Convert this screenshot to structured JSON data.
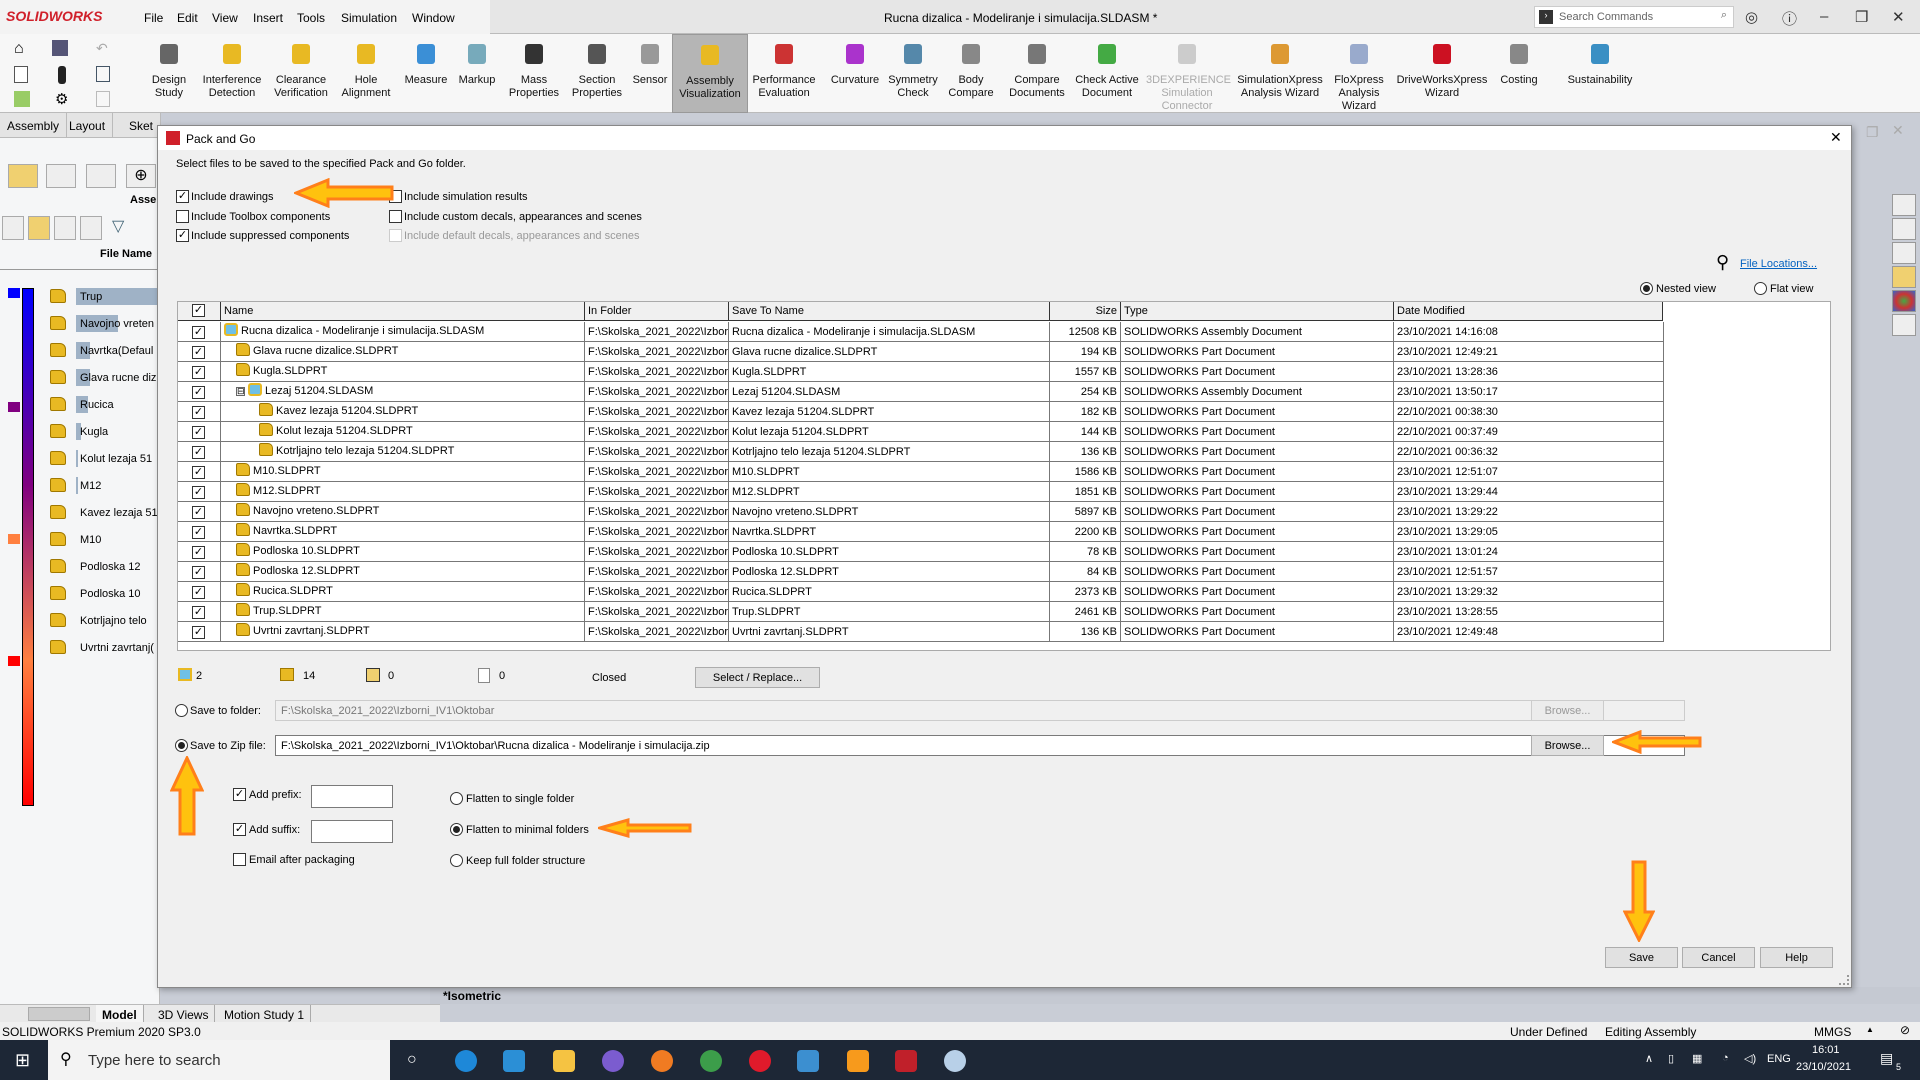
{
  "app": {
    "logo": "SOLIDWORKS",
    "title": "Rucna dizalica - Modeliranje i simulacija.SLDASM *",
    "menu": [
      "File",
      "Edit",
      "View",
      "Insert",
      "Tools",
      "Simulation",
      "Window"
    ],
    "search_placeholder": "Search Commands"
  },
  "toolbar": [
    {
      "l1": "Design",
      "l2": "Study",
      "c": "#666"
    },
    {
      "l1": "Interference",
      "l2": "Detection",
      "c": "#e8b923"
    },
    {
      "l1": "Clearance",
      "l2": "Verification",
      "c": "#e8b923"
    },
    {
      "l1": "Hole",
      "l2": "Alignment",
      "c": "#e8b923"
    },
    {
      "l1": "Measure",
      "l2": "",
      "c": "#3b8fd6"
    },
    {
      "l1": "Markup",
      "l2": "",
      "c": "#7ab"
    },
    {
      "l1": "Mass",
      "l2": "Properties",
      "c": "#333"
    },
    {
      "l1": "Section",
      "l2": "Properties",
      "c": "#555"
    },
    {
      "l1": "Sensor",
      "l2": "",
      "c": "#999"
    },
    {
      "l1": "Assembly",
      "l2": "Visualization",
      "c": "#e8b923",
      "active": true
    },
    {
      "l1": "Performance",
      "l2": "Evaluation",
      "c": "#c33"
    },
    {
      "l1": "Curvature",
      "l2": "",
      "c": "#a3c"
    },
    {
      "l1": "Symmetry",
      "l2": "Check",
      "c": "#58a"
    },
    {
      "l1": "Body",
      "l2": "Compare",
      "c": "#888"
    },
    {
      "l1": "Compare",
      "l2": "Documents",
      "c": "#777"
    },
    {
      "l1": "Check Active",
      "l2": "Document",
      "c": "#4a4"
    },
    {
      "l1": "3DEXPERIENCE",
      "l2": "Simulation",
      "l3": "Connector",
      "c": "#ccc",
      "disabled": true
    },
    {
      "l1": "SimulationXpress",
      "l2": "Analysis Wizard",
      "c": "#d93"
    },
    {
      "l1": "FloXpress",
      "l2": "Analysis",
      "l3": "Wizard",
      "c": "#9ac"
    },
    {
      "l1": "DriveWorksXpress",
      "l2": "Wizard",
      "c": "#c12"
    },
    {
      "l1": "Costing",
      "l2": "",
      "c": "#888"
    },
    {
      "l1": "Sustainability",
      "l2": "",
      "c": "#3a8fc4"
    }
  ],
  "cmd_tabs": [
    "Assembly",
    "Layout",
    "Sket"
  ],
  "left_panel": {
    "header": "Asse",
    "column": "File Name",
    "items": [
      {
        "name": "Trup",
        "fill": 1.0
      },
      {
        "name": "Navojno vreten",
        "fill": 0.5
      },
      {
        "name": "Navrtka(Defaul",
        "fill": 0.17
      },
      {
        "name": "Glava rucne diz",
        "fill": 0.17
      },
      {
        "name": "Rucica",
        "fill": 0.14
      },
      {
        "name": "Kugla",
        "fill": 0.06
      },
      {
        "name": "Kolut lezaja 51",
        "fill": 0.02
      },
      {
        "name": "M12",
        "fill": 0.02
      },
      {
        "name": "Kavez lezaja 51",
        "fill": 0
      },
      {
        "name": "M10",
        "fill": 0
      },
      {
        "name": "Podloska 12",
        "fill": 0
      },
      {
        "name": "Podloska 10",
        "fill": 0
      },
      {
        "name": "Kotrljajno telo",
        "fill": 0
      },
      {
        "name": "Uvrtni zavrtanj(",
        "fill": 0
      }
    ],
    "scale_colors": [
      "#0000ff",
      "#800080",
      "#ff8040",
      "#ff0000"
    ]
  },
  "dialog": {
    "title": "Pack and Go",
    "intro": "Select files to be saved to the specified Pack and Go folder.",
    "options": [
      {
        "label": "Include drawings",
        "checked": true
      },
      {
        "label": "Include Toolbox components",
        "checked": false
      },
      {
        "label": "Include suppressed components",
        "checked": true
      },
      {
        "label": "Include simulation results",
        "checked": false
      },
      {
        "label": "Include custom decals, appearances and scenes",
        "checked": false
      },
      {
        "label": "Include default decals, appearances and scenes",
        "checked": false,
        "disabled": true
      }
    ],
    "file_locations": "File Locations...",
    "views": [
      {
        "label": "Nested view",
        "selected": true
      },
      {
        "label": "Flat view",
        "selected": false
      }
    ],
    "columns": [
      "Name",
      "In Folder",
      "Save To Name",
      "Size",
      "Type",
      "Date Modified"
    ],
    "rows": [
      {
        "name": "Rucna dizalica - Modeliranje i simulacija.SLDASM",
        "kind": "asm",
        "level": 0,
        "folder": "F:\\Skolska_2021_2022\\Izbor",
        "save": "Rucna dizalica - Modeliranje i simulacija.SLDASM",
        "size": "12508 KB",
        "type": "SOLIDWORKS Assembly Document",
        "date": "23/10/2021 14:16:08"
      },
      {
        "name": "Glava rucne dizalice.SLDPRT",
        "kind": "prt",
        "level": 1,
        "folder": "F:\\Skolska_2021_2022\\Izbor",
        "save": "Glava rucne dizalice.SLDPRT",
        "size": "194 KB",
        "type": "SOLIDWORKS Part Document",
        "date": "23/10/2021 12:49:21"
      },
      {
        "name": "Kugla.SLDPRT",
        "kind": "prt",
        "level": 1,
        "folder": "F:\\Skolska_2021_2022\\Izbor",
        "save": "Kugla.SLDPRT",
        "size": "1557 KB",
        "type": "SOLIDWORKS Part Document",
        "date": "23/10/2021 13:28:36"
      },
      {
        "name": "Lezaj 51204.SLDASM",
        "kind": "asm",
        "level": 1,
        "expander": "⊟",
        "folder": "F:\\Skolska_2021_2022\\Izbor",
        "save": "Lezaj 51204.SLDASM",
        "size": "254 KB",
        "type": "SOLIDWORKS Assembly Document",
        "date": "23/10/2021 13:50:17"
      },
      {
        "name": "Kavez lezaja 51204.SLDPRT",
        "kind": "prt",
        "level": 2,
        "folder": "F:\\Skolska_2021_2022\\Izbor",
        "save": "Kavez lezaja 51204.SLDPRT",
        "size": "182 KB",
        "type": "SOLIDWORKS Part Document",
        "date": "22/10/2021 00:38:30"
      },
      {
        "name": "Kolut lezaja 51204.SLDPRT",
        "kind": "prt",
        "level": 2,
        "folder": "F:\\Skolska_2021_2022\\Izbor",
        "save": "Kolut lezaja 51204.SLDPRT",
        "size": "144 KB",
        "type": "SOLIDWORKS Part Document",
        "date": "22/10/2021 00:37:49"
      },
      {
        "name": "Kotrljajno telo lezaja 51204.SLDPRT",
        "kind": "prt",
        "level": 2,
        "folder": "F:\\Skolska_2021_2022\\Izbor",
        "save": "Kotrljajno telo lezaja 51204.SLDPRT",
        "size": "136 KB",
        "type": "SOLIDWORKS Part Document",
        "date": "22/10/2021 00:36:32"
      },
      {
        "name": "M10.SLDPRT",
        "kind": "prt",
        "level": 1,
        "folder": "F:\\Skolska_2021_2022\\Izbor",
        "save": "M10.SLDPRT",
        "size": "1586 KB",
        "type": "SOLIDWORKS Part Document",
        "date": "23/10/2021 12:51:07"
      },
      {
        "name": "M12.SLDPRT",
        "kind": "prt",
        "level": 1,
        "folder": "F:\\Skolska_2021_2022\\Izbor",
        "save": "M12.SLDPRT",
        "size": "1851 KB",
        "type": "SOLIDWORKS Part Document",
        "date": "23/10/2021 13:29:44"
      },
      {
        "name": "Navojno vreteno.SLDPRT",
        "kind": "prt",
        "level": 1,
        "folder": "F:\\Skolska_2021_2022\\Izbor",
        "save": "Navojno vreteno.SLDPRT",
        "size": "5897 KB",
        "type": "SOLIDWORKS Part Document",
        "date": "23/10/2021 13:29:22"
      },
      {
        "name": "Navrtka.SLDPRT",
        "kind": "prt",
        "level": 1,
        "folder": "F:\\Skolska_2021_2022\\Izbor",
        "save": "Navrtka.SLDPRT",
        "size": "2200 KB",
        "type": "SOLIDWORKS Part Document",
        "date": "23/10/2021 13:29:05"
      },
      {
        "name": "Podloska 10.SLDPRT",
        "kind": "prt",
        "level": 1,
        "folder": "F:\\Skolska_2021_2022\\Izbor",
        "save": "Podloska 10.SLDPRT",
        "size": "78 KB",
        "type": "SOLIDWORKS Part Document",
        "date": "23/10/2021 13:01:24"
      },
      {
        "name": "Podloska 12.SLDPRT",
        "kind": "prt",
        "level": 1,
        "folder": "F:\\Skolska_2021_2022\\Izbor",
        "save": "Podloska 12.SLDPRT",
        "size": "84 KB",
        "type": "SOLIDWORKS Part Document",
        "date": "23/10/2021 12:51:57"
      },
      {
        "name": "Rucica.SLDPRT",
        "kind": "prt",
        "level": 1,
        "folder": "F:\\Skolska_2021_2022\\Izbor",
        "save": "Rucica.SLDPRT",
        "size": "2373 KB",
        "type": "SOLIDWORKS Part Document",
        "date": "23/10/2021 13:29:32"
      },
      {
        "name": "Trup.SLDPRT",
        "kind": "prt",
        "level": 1,
        "folder": "F:\\Skolska_2021_2022\\Izbor",
        "save": "Trup.SLDPRT",
        "size": "2461 KB",
        "type": "SOLIDWORKS Part Document",
        "date": "23/10/2021 13:28:55"
      },
      {
        "name": "Uvrtni zavrtanj.SLDPRT",
        "kind": "prt",
        "level": 1,
        "folder": "F:\\Skolska_2021_2022\\Izbor",
        "save": "Uvrtni zavrtanj.SLDPRT",
        "size": "136 KB",
        "type": "SOLIDWORKS Part Document",
        "date": "23/10/2021 12:49:48"
      }
    ],
    "counts": {
      "assemblies": "2",
      "parts": "14",
      "drawings": "0",
      "other": "0",
      "status": "Closed"
    },
    "select_replace": "Select / Replace...",
    "save_to_folder": {
      "label": "Save to folder:",
      "value": "F:\\Skolska_2021_2022\\Izborni_IV1\\Oktobar",
      "selected": false
    },
    "save_to_zip": {
      "label": "Save to Zip file:",
      "value": "F:\\Skolska_2021_2022\\Izborni_IV1\\Oktobar\\Rucna dizalica - Modeliranje i simulacija.zip",
      "selected": true
    },
    "browse": "Browse...",
    "add_prefix": {
      "label": "Add prefix:",
      "checked": true,
      "value": ""
    },
    "add_suffix": {
      "label": "Add suffix:",
      "checked": true,
      "value": ""
    },
    "email": {
      "label": "Email after packaging",
      "checked": false
    },
    "structure": [
      {
        "label": "Flatten to single folder",
        "selected": false
      },
      {
        "label": "Flatten to minimal folders",
        "selected": true
      },
      {
        "label": "Keep full folder structure",
        "selected": false
      }
    ],
    "buttons": {
      "save": "Save",
      "cancel": "Cancel",
      "help": "Help"
    },
    "annotation_color": "#ff8c1a"
  },
  "viewport": {
    "view_label": "*Isometric"
  },
  "bottom_tabs": [
    "Model",
    "3D Views",
    "Motion Study 1"
  ],
  "status": {
    "product": "SOLIDWORKS Premium 2020 SP3.0",
    "defined": "Under Defined",
    "mode": "Editing Assembly",
    "units": "MMGS"
  },
  "taskbar": {
    "search_placeholder": "Type here to search",
    "lang": "ENG",
    "time": "16:01",
    "date": "23/10/2021",
    "notifications": "5"
  }
}
